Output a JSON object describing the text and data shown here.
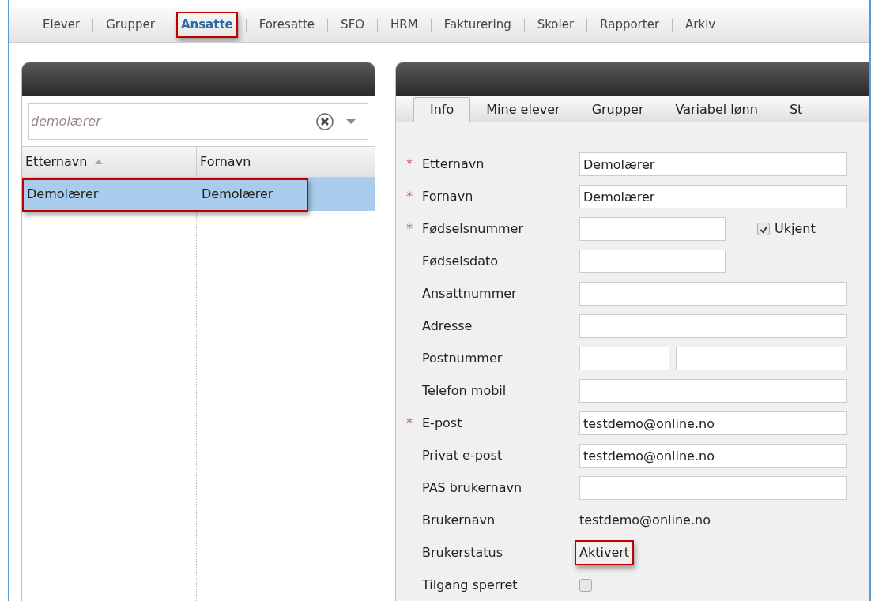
{
  "nav": [
    {
      "label": "Elever",
      "selected": false,
      "highlighted": false
    },
    {
      "label": "Grupper",
      "selected": false,
      "highlighted": false
    },
    {
      "label": "Ansatte",
      "selected": true,
      "highlighted": true
    },
    {
      "label": "Foresatte",
      "selected": false,
      "highlighted": false
    },
    {
      "label": "SFO",
      "selected": false,
      "highlighted": false
    },
    {
      "label": "HRM",
      "selected": false,
      "highlighted": false
    },
    {
      "label": "Fakturering",
      "selected": false,
      "highlighted": false
    },
    {
      "label": "Skoler",
      "selected": false,
      "highlighted": false
    },
    {
      "label": "Rapporter",
      "selected": false,
      "highlighted": false
    },
    {
      "label": "Arkiv",
      "selected": false,
      "highlighted": false
    }
  ],
  "search": {
    "placeholder": "demolærer"
  },
  "table": {
    "columns": [
      {
        "label": "Etternavn",
        "sorted": true
      },
      {
        "label": "Fornavn",
        "sorted": false
      }
    ],
    "rows": [
      {
        "cells": [
          "Demolærer",
          "Demolærer"
        ],
        "selected": true,
        "highlighted": true
      }
    ]
  },
  "tabs": [
    {
      "label": "Info",
      "selected": true
    },
    {
      "label": "Mine elever",
      "selected": false
    },
    {
      "label": "Grupper",
      "selected": false
    },
    {
      "label": "Variabel lønn",
      "selected": false
    },
    {
      "label": "St",
      "selected": false
    }
  ],
  "form": [
    {
      "kind": "input",
      "required_mark": "*",
      "label": "Etternavn",
      "value": "Demolærer"
    },
    {
      "kind": "input",
      "required_mark": "*",
      "label": "Fornavn",
      "value": "Demolærer"
    },
    {
      "kind": "short_input",
      "required_mark": "*",
      "label": "Fødselsnummer",
      "extra": {
        "label": "Ukjent",
        "checked": true
      }
    },
    {
      "kind": "short_input",
      "label": "Fødselsdato"
    },
    {
      "kind": "input",
      "label": "Ansattnummer"
    },
    {
      "kind": "input",
      "label": "Adresse"
    },
    {
      "kind": "pair",
      "label": "Postnummer"
    },
    {
      "kind": "input",
      "label": "Telefon mobil"
    },
    {
      "kind": "input",
      "required_mark": "*",
      "label": "E-post",
      "value": "testdemo@online.no"
    },
    {
      "kind": "input",
      "label": "Privat e-post",
      "value": "testdemo@online.no"
    },
    {
      "kind": "input",
      "label": "PAS brukernavn"
    },
    {
      "kind": "text",
      "label": "Brukernavn",
      "value": "testdemo@online.no",
      "highlighted": false
    },
    {
      "kind": "text",
      "label": "Brukerstatus",
      "value": "Aktivert",
      "highlighted": true
    },
    {
      "kind": "checkbox",
      "label": "Tilgang sperret",
      "checked": false
    }
  ]
}
